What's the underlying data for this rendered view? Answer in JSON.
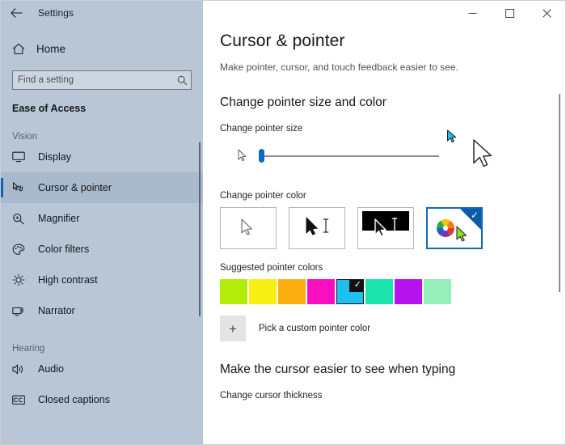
{
  "window": {
    "app_title": "Settings",
    "back_icon": "back-arrow-icon",
    "controls": {
      "minimize": "–",
      "maximize": "☐",
      "close": "✕"
    }
  },
  "sidebar": {
    "home_label": "Home",
    "home_icon": "home-icon",
    "search": {
      "placeholder": "Find a setting",
      "value": "",
      "icon": "search-icon"
    },
    "category": "Ease of Access",
    "groups": [
      {
        "label": "Vision",
        "items": [
          {
            "label": "Display",
            "icon": "monitor-icon",
            "selected": false
          },
          {
            "label": "Cursor & pointer",
            "icon": "cursor-hand-icon",
            "selected": true
          },
          {
            "label": "Magnifier",
            "icon": "magnifier-icon",
            "selected": false
          },
          {
            "label": "Color filters",
            "icon": "palette-icon",
            "selected": false
          },
          {
            "label": "High contrast",
            "icon": "brightness-icon",
            "selected": false
          },
          {
            "label": "Narrator",
            "icon": "narrator-icon",
            "selected": false
          }
        ]
      },
      {
        "label": "Hearing",
        "items": [
          {
            "label": "Audio",
            "icon": "speaker-icon",
            "selected": false
          },
          {
            "label": "Closed captions",
            "icon": "closed-captions-icon",
            "selected": false
          }
        ]
      }
    ]
  },
  "main": {
    "title": "Cursor & pointer",
    "subtitle": "Make pointer, cursor, and touch feedback easier to see.",
    "size_section": {
      "heading": "Change pointer size and color",
      "slider_label": "Change pointer size",
      "slider_value": 1,
      "slider_min": 1,
      "slider_max": 15
    },
    "color_section": {
      "label": "Change pointer color",
      "options": [
        {
          "name": "white-pointer-option",
          "selected": false
        },
        {
          "name": "black-pointer-option",
          "selected": false
        },
        {
          "name": "inverted-pointer-option",
          "selected": false
        },
        {
          "name": "custom-color-pointer-option",
          "selected": true
        }
      ]
    },
    "suggested": {
      "label": "Suggested pointer colors",
      "swatches": [
        {
          "name": "lime",
          "color": "#b4ec0a",
          "selected": false
        },
        {
          "name": "yellow",
          "color": "#f9f013",
          "selected": false
        },
        {
          "name": "orange",
          "color": "#fbae10",
          "selected": false
        },
        {
          "name": "magenta",
          "color": "#f90ec0",
          "selected": false
        },
        {
          "name": "cyan",
          "color": "#1ec0f0",
          "selected": true
        },
        {
          "name": "spring-green",
          "color": "#1ae3ab",
          "selected": false
        },
        {
          "name": "purple",
          "color": "#b514ef",
          "selected": false
        },
        {
          "name": "mint",
          "color": "#96eebb",
          "selected": false
        }
      ],
      "check_glyph": "✓"
    },
    "custom": {
      "plus_glyph": "+",
      "label": "Pick a custom pointer color"
    },
    "typing_section": {
      "heading": "Make the cursor easier to see when typing",
      "field_label": "Change cursor thickness"
    },
    "accent_color": "#0f6cbd",
    "pointer_preview_color": "#1ec0f0"
  }
}
